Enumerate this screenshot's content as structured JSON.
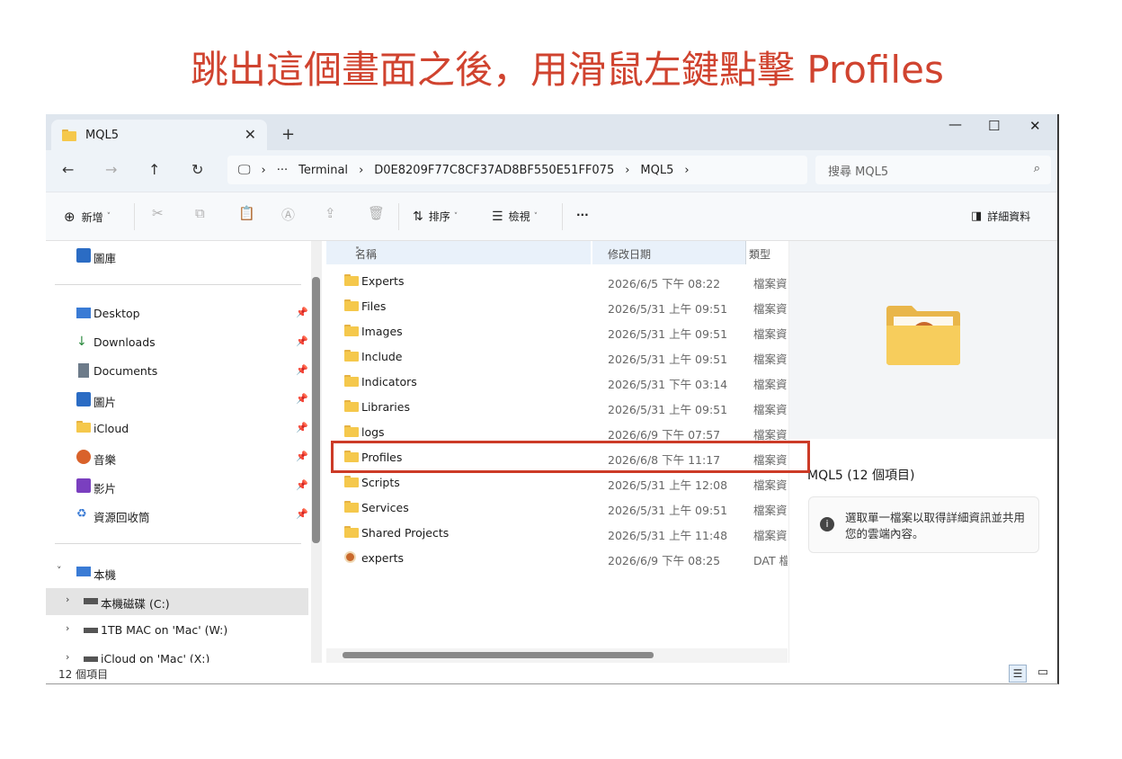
{
  "banner": {
    "text": "跳出這個畫面之後，用滑鼠左鍵點擊 Profiles"
  },
  "window": {
    "tab_title": "MQL5",
    "controls": {
      "minimize": "—",
      "maximize": "☐",
      "close": "✕"
    }
  },
  "nav": {
    "breadcrumb": [
      "Terminal",
      "D0E8209F77C8CF37AD8BF550E51FF075",
      "MQL5"
    ],
    "ellipsis": "···",
    "search_placeholder": "搜尋 MQL5"
  },
  "toolbar": {
    "new_label": "新增",
    "sort_label": "排序",
    "view_label": "檢視",
    "more_label": "···",
    "details_label": "詳細資料"
  },
  "sidebar": {
    "gallery": "圖庫",
    "pinned": [
      {
        "label": "Desktop",
        "icon": "desktop-icon"
      },
      {
        "label": "Downloads",
        "icon": "download-icon"
      },
      {
        "label": "Documents",
        "icon": "documents-icon"
      },
      {
        "label": "圖片",
        "icon": "pictures-icon"
      },
      {
        "label": "iCloud",
        "icon": "folder-icon"
      },
      {
        "label": "音樂",
        "icon": "music-icon"
      },
      {
        "label": "影片",
        "icon": "video-icon"
      },
      {
        "label": "資源回收筒",
        "icon": "recycle-bin-icon"
      }
    ],
    "this_pc": "本機",
    "drives": [
      {
        "label": "本機磁碟 (C:)",
        "selected": true
      },
      {
        "label": "1TB MAC on 'Mac' (W:)",
        "selected": false
      },
      {
        "label": "iCloud on 'Mac' (X:)",
        "selected": false
      }
    ]
  },
  "columns": {
    "name": "名稱",
    "date": "修改日期",
    "type": "類型"
  },
  "files": [
    {
      "name": "Experts",
      "date": "2026/6/5 下午 08:22",
      "type": "檔案資"
    },
    {
      "name": "Files",
      "date": "2026/5/31 上午 09:51",
      "type": "檔案資"
    },
    {
      "name": "Images",
      "date": "2026/5/31 上午 09:51",
      "type": "檔案資"
    },
    {
      "name": "Include",
      "date": "2026/5/31 上午 09:51",
      "type": "檔案資"
    },
    {
      "name": "Indicators",
      "date": "2026/5/31 下午 03:14",
      "type": "檔案資"
    },
    {
      "name": "Libraries",
      "date": "2026/5/31 上午 09:51",
      "type": "檔案資"
    },
    {
      "name": "logs",
      "date": "2026/6/9 下午 07:57",
      "type": "檔案資"
    },
    {
      "name": "Profiles",
      "date": "2026/6/8 下午 11:17",
      "type": "檔案資"
    },
    {
      "name": "Scripts",
      "date": "2026/5/31 上午 12:08",
      "type": "檔案資"
    },
    {
      "name": "Services",
      "date": "2026/5/31 上午 09:51",
      "type": "檔案資"
    },
    {
      "name": "Shared Projects",
      "date": "2026/5/31 上午 11:48",
      "type": "檔案資"
    },
    {
      "name": "experts",
      "date": "2026/6/9 下午 08:25",
      "type": "DAT 檔"
    }
  ],
  "details": {
    "title": "MQL5 (12 個項目)",
    "info_text": "選取單一檔案以取得詳細資訊並共用您的雲端內容。"
  },
  "status": {
    "count": "12 個項目"
  },
  "colors": {
    "banner": "#d0432f",
    "highlight": "#cc3b27",
    "folder": "#f5c84c"
  }
}
